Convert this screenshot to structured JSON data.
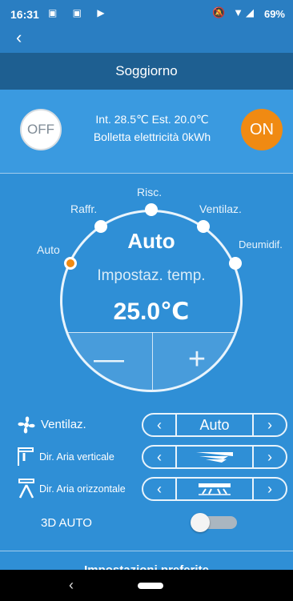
{
  "status_bar": {
    "time": "16:31",
    "left_icons": "▣ ▣ ▶",
    "right_icons": "🔕 ▼◢",
    "battery": "69%"
  },
  "header": {
    "back_icon": "‹",
    "title": "Soggiorno"
  },
  "power": {
    "off_label": "OFF",
    "on_label": "ON",
    "temps_line": "Int. 28.5℃  Est. 20.0℃",
    "bill_line": "Bolletta elettricità 0kWh"
  },
  "dial": {
    "modes": {
      "auto": "Auto",
      "cool": "Raffr.",
      "heat": "Risc.",
      "fan": "Ventilaz.",
      "dry": "Deumidif."
    },
    "current_mode": "Auto",
    "set_temp_label": "Impostaz. temp.",
    "temp_value": "25.0℃",
    "minus": "—",
    "plus": "+"
  },
  "controls": {
    "fan": {
      "label": "Ventilaz.",
      "value": "Auto",
      "left": "‹",
      "right": "›"
    },
    "vertical": {
      "label": "Dir. Aria verticale",
      "left": "‹",
      "right": "›"
    },
    "horizontal": {
      "label": "Dir. Aria orizzontale",
      "left": "‹",
      "right": "›"
    },
    "auto3d": {
      "label": "3D AUTO"
    }
  },
  "preferences_label": "Impostazioni preferite",
  "nav": {
    "back": "‹"
  },
  "colors": {
    "background": "#2f8fd6",
    "title_bar": "#1e5f91",
    "accent_orange": "#f08a12"
  }
}
